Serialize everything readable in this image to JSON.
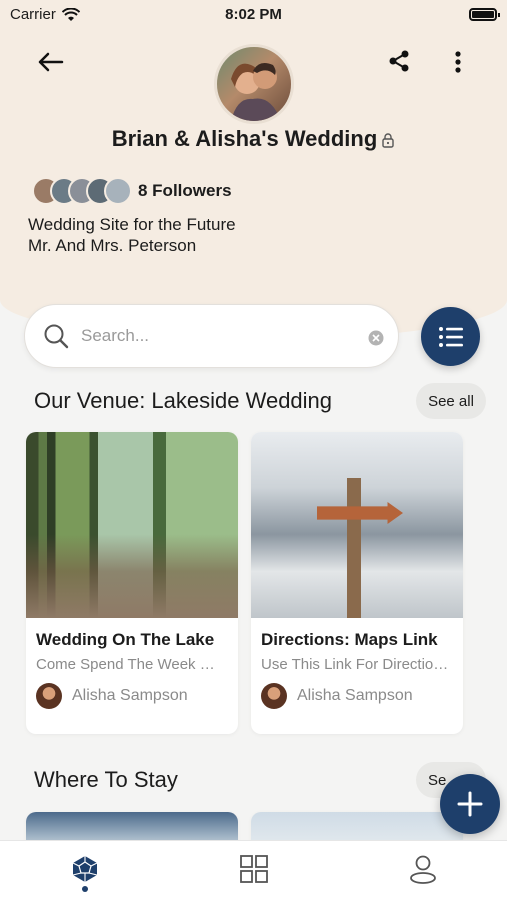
{
  "status_bar": {
    "carrier": "Carrier",
    "time": "8:02 PM"
  },
  "header": {
    "title": "Brian & Alisha's Wedding",
    "followers_label": "8 Followers",
    "description_line1": "Wedding Site for the Future",
    "description_line2": "Mr. And Mrs. Peterson"
  },
  "search": {
    "placeholder": "Search..."
  },
  "sections": {
    "venue": {
      "title": "Our Venue: Lakeside Wedding",
      "see_all": "See all",
      "cards": [
        {
          "title": "Wedding On The Lake",
          "subtitle": "Come Spend The Week Wi...",
          "author": "Alisha Sampson"
        },
        {
          "title": "Directions: Maps Link",
          "subtitle": "Use This Link For Direction...",
          "author": "Alisha Sampson"
        }
      ]
    },
    "stay": {
      "title": "Where To Stay",
      "see_all": "Se"
    }
  },
  "colors": {
    "accent": "#1e3f6b",
    "header_bg": "#f5ece2"
  },
  "tabs": [
    {
      "name": "home",
      "icon": "dodecahedron-icon",
      "active": true
    },
    {
      "name": "grid",
      "icon": "grid-icon",
      "active": false
    },
    {
      "name": "profile",
      "icon": "user-icon",
      "active": false
    }
  ]
}
